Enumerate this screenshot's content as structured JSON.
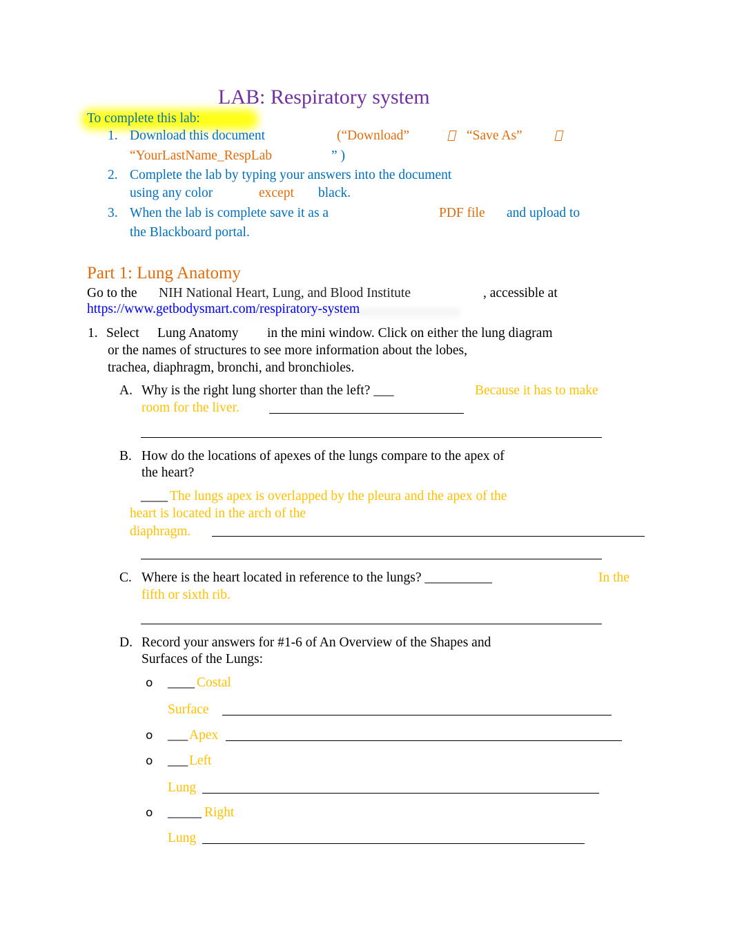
{
  "document": {
    "title": "LAB: Respiratory system",
    "instructions_heading": "To complete this lab:",
    "steps": [
      {
        "number": "1.",
        "text": "Download this document",
        "orange_parts": [
          "(“Download”",
          "“Save As”"
        ],
        "arrow_icon": "arrow-right-icon",
        "filename": "“YourLastName_RespLab",
        "filename_close": "” )"
      },
      {
        "number": "2.",
        "line1": "Complete the lab by typing your answers into the document",
        "line2_a": "using any color",
        "line2_b": "except",
        "line2_c": "black."
      },
      {
        "number": "3.",
        "line1_a": "When the lab is complete save it as a",
        "line1_b": "PDF file",
        "line1_c": "and upload to",
        "line2": "the Blackboard portal."
      }
    ],
    "part1": {
      "heading": "Part 1: Lung Anatomy",
      "intro_a": "Go to the",
      "intro_b": "NIH National Heart, Lung, and Blood Institute",
      "intro_c": ", accessible at",
      "link": "https://www.getbodysmart.com/respiratory-system",
      "q1": {
        "number": "1.",
        "line1_a": "Select",
        "line1_b": "Lung Anatomy",
        "line1_c": "in the mini window. Click on either the lung diagram",
        "line2": "or the names of structures to see more information about the lobes,",
        "line3": "trachea, diaphragm, bronchi, and bronchioles."
      },
      "questions": [
        {
          "letter": "A.",
          "question": "Why is the right lung shorter than the left? ___",
          "answer_line1": "Because it has to make",
          "answer_line2": "room for the liver."
        },
        {
          "letter": "B.",
          "question_line1": "How do the locations of apexes of the lungs compare to the apex of",
          "question_line2": "the heart?",
          "answer_prefix": "____",
          "answer_line1": "The lungs apex is overlapped by the pleura and the apex of the",
          "answer_line2": "heart is located in the arch of the",
          "answer_line3": "diaphragm."
        },
        {
          "letter": "C.",
          "question": "Where is the heart located in reference to the lungs? __________",
          "answer_line1": "In the",
          "answer_line2": "fifth or sixth rib."
        },
        {
          "letter": "D.",
          "question_line1": "Record your answers for #1-6 of An Overview of the Shapes and",
          "question_line2": "Surfaces of the Lungs:",
          "bullet": "o",
          "answers": [
            {
              "prefix": "____",
              "line1": "Costal",
              "line2": "Surface"
            },
            {
              "prefix": "___",
              "line1": "Apex"
            },
            {
              "prefix": "___",
              "line1": "Left",
              "line2": "Lung"
            },
            {
              "prefix": "_____",
              "line1": "Right",
              "line2": "Lung"
            }
          ]
        }
      ]
    }
  }
}
